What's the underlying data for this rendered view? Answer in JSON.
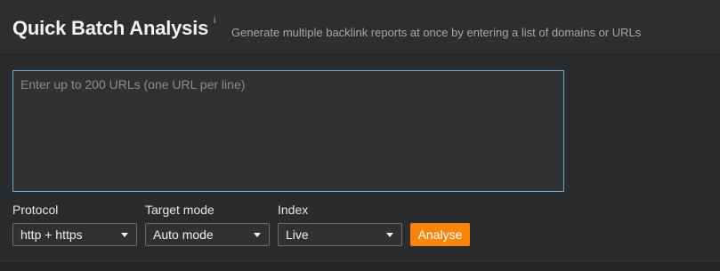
{
  "header": {
    "title": "Quick Batch Analysis",
    "info_mark": "i",
    "subtitle": "Generate multiple backlink reports at once by entering a list of domains or URLs"
  },
  "form": {
    "urls": {
      "value": "",
      "placeholder": "Enter up to 200 URLs (one URL per line)"
    },
    "protocol": {
      "label": "Protocol",
      "selected": "http + https"
    },
    "target_mode": {
      "label": "Target mode",
      "selected": "Auto mode"
    },
    "index": {
      "label": "Index",
      "selected": "Live"
    },
    "analyse_label": "Analyse"
  },
  "colors": {
    "accent": "#f7860b",
    "textarea_border": "#7aa6c8",
    "background": "#2b2c2d"
  }
}
